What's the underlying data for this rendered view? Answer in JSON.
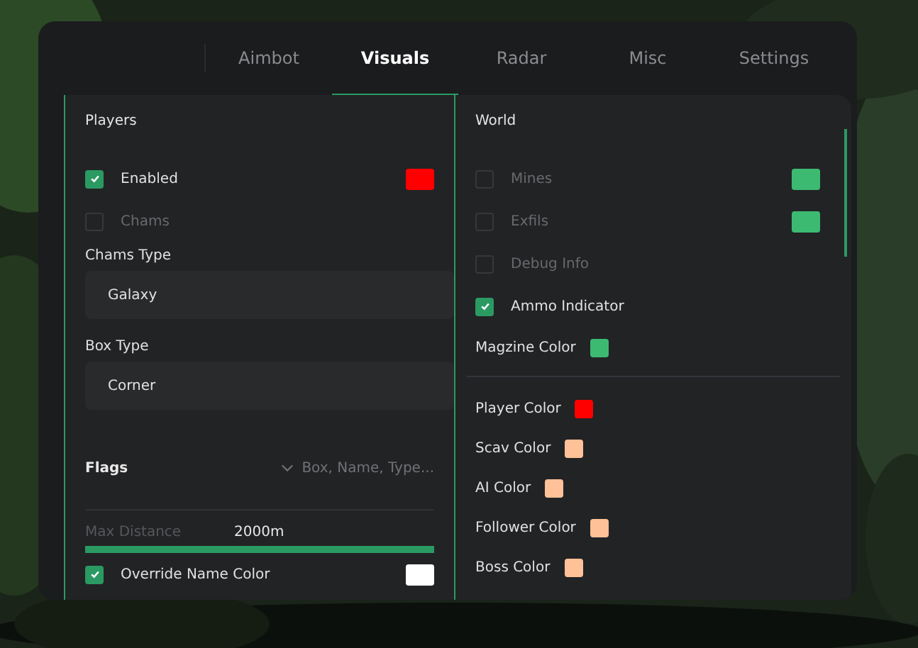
{
  "tabs": [
    {
      "label": "Aimbot",
      "selected": false
    },
    {
      "label": "Visuals",
      "selected": true
    },
    {
      "label": "Radar",
      "selected": false
    },
    {
      "label": "Misc",
      "selected": false
    },
    {
      "label": "Settings",
      "selected": false
    }
  ],
  "players": {
    "title": "Players",
    "items": [
      {
        "kind": "checkbox",
        "label": "Enabled",
        "checked": true,
        "color": "#ff0000"
      },
      {
        "kind": "checkbox",
        "label": "Chams",
        "checked": false
      },
      {
        "kind": "dropdown",
        "label": "Chams Type",
        "value": "Galaxy"
      },
      {
        "kind": "dropdown",
        "label": "Box Type",
        "value": "Corner"
      },
      {
        "kind": "multiselect",
        "label": "Flags",
        "placeholder": "Box, Name, Type..."
      },
      {
        "kind": "slider",
        "label": "Max Distance",
        "reading": "2000m",
        "level": 1
      },
      {
        "kind": "checkbox",
        "label": "Override Name Color",
        "checked": true,
        "color": "#ffffff"
      }
    ]
  },
  "world": {
    "title": "World",
    "items": [
      {
        "kind": "checkbox",
        "label": "Mines",
        "checked": false,
        "color": "#3dba72"
      },
      {
        "kind": "checkbox",
        "label": "Exfils",
        "checked": false,
        "color": "#3dba72"
      },
      {
        "kind": "checkbox",
        "label": "Debug Info",
        "checked": false
      },
      {
        "kind": "checkbox",
        "label": "Ammo Indicator",
        "checked": true
      },
      {
        "kind": "color",
        "label": "Magzine Color",
        "color": "#3dba72"
      },
      {
        "kind": "divider"
      },
      {
        "kind": "color",
        "label": "Player Color",
        "color": "#ff0000"
      },
      {
        "kind": "color",
        "label": "Scav Color",
        "color": "#ffc197"
      },
      {
        "kind": "color",
        "label": "AI Color",
        "color": "#ffc197"
      },
      {
        "kind": "color",
        "label": "Follower Color",
        "color": "#ffc197"
      },
      {
        "kind": "color",
        "label": "Boss Color",
        "color": "#ffc197"
      }
    ]
  }
}
